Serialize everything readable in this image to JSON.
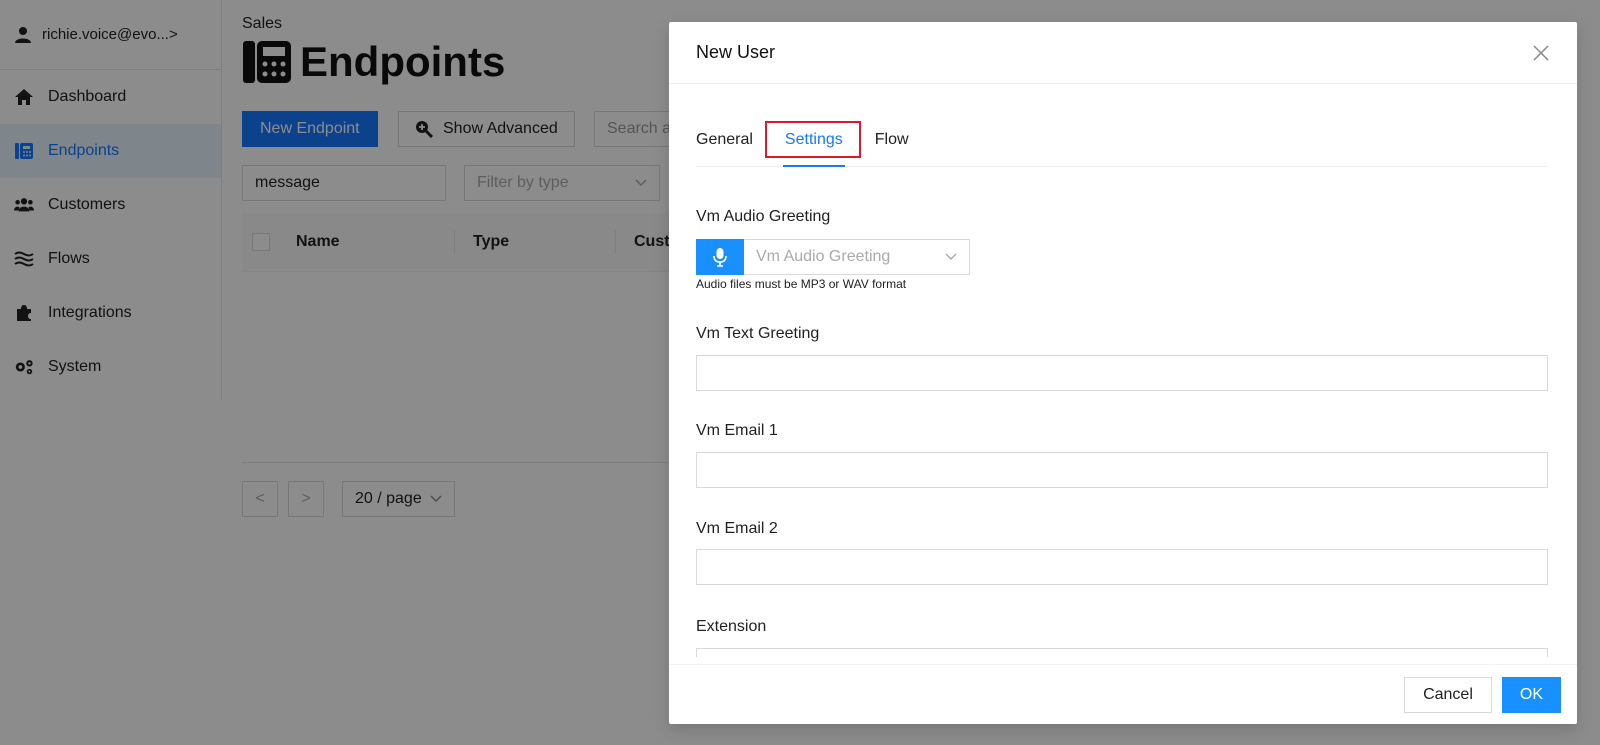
{
  "sidebar": {
    "user": "richie.voice@evo...>",
    "items": [
      {
        "label": "Dashboard",
        "icon": "home-icon"
      },
      {
        "label": "Endpoints",
        "icon": "phone-icon",
        "active": true
      },
      {
        "label": "Customers",
        "icon": "users-icon"
      },
      {
        "label": "Flows",
        "icon": "flows-icon"
      },
      {
        "label": "Integrations",
        "icon": "puzzle-icon"
      },
      {
        "label": "System",
        "icon": "gears-icon"
      }
    ]
  },
  "header": {
    "section": "Sales",
    "title": "Endpoints"
  },
  "toolbar": {
    "new_endpoint_label": "New Endpoint",
    "show_advanced_label": "Show Advanced",
    "search_placeholder": "Search a"
  },
  "filters": {
    "message_value": "message",
    "type_placeholder": "Filter by type"
  },
  "table": {
    "columns": [
      "Name",
      "Type",
      "Custo"
    ]
  },
  "pagination": {
    "prev": "<",
    "next": ">",
    "page_size": "20 / page"
  },
  "modal": {
    "title": "New User",
    "tabs": [
      {
        "label": "General"
      },
      {
        "label": "Settings",
        "active": true
      },
      {
        "label": "Flow"
      }
    ],
    "fields": {
      "vm_audio_label": "Vm Audio Greeting",
      "vm_audio_placeholder": "Vm Audio Greeting",
      "vm_audio_hint": "Audio files must be MP3 or WAV format",
      "vm_text_label": "Vm Text Greeting",
      "vm_email1_label": "Vm Email 1",
      "vm_email2_label": "Vm Email 2",
      "extension_label": "Extension"
    },
    "cancel_label": "Cancel",
    "ok_label": "OK"
  },
  "colors": {
    "primary": "#1677ff",
    "highlight_border": "#e0162b",
    "overlay": "rgba(0,0,0,0.45)"
  }
}
